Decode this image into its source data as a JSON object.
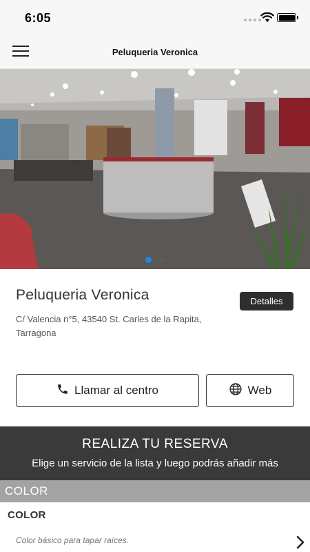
{
  "status_bar": {
    "time": "6:05"
  },
  "header": {
    "title": "Peluqueria Veronica",
    "menu_icon": "hamburger-icon"
  },
  "gallery": {
    "page_count": 2,
    "active_index": 0
  },
  "salon": {
    "name": "Peluqueria Veronica",
    "details_label": "Detalles",
    "address": "C/ Valencia n°5, 43540 St. Carles de la Rapita, Tarragona"
  },
  "actions": {
    "call_label": "Llamar al centro",
    "call_icon": "phone-icon",
    "web_label": "Web",
    "web_icon": "globe-icon"
  },
  "reservation": {
    "title": "REALIZA TU RESERVA",
    "subtitle": "Elige un servicio de la lista y luego podrás añadir más"
  },
  "category": {
    "label": "COLOR"
  },
  "services": [
    {
      "name": "COLOR",
      "description": "Color básico para tapar raíces."
    }
  ],
  "colors": {
    "accent_blue": "#1e88e5",
    "dark_band": "#3a3a3a",
    "category_gray": "#a3a3a3",
    "button_dark": "#2e2e2e"
  }
}
